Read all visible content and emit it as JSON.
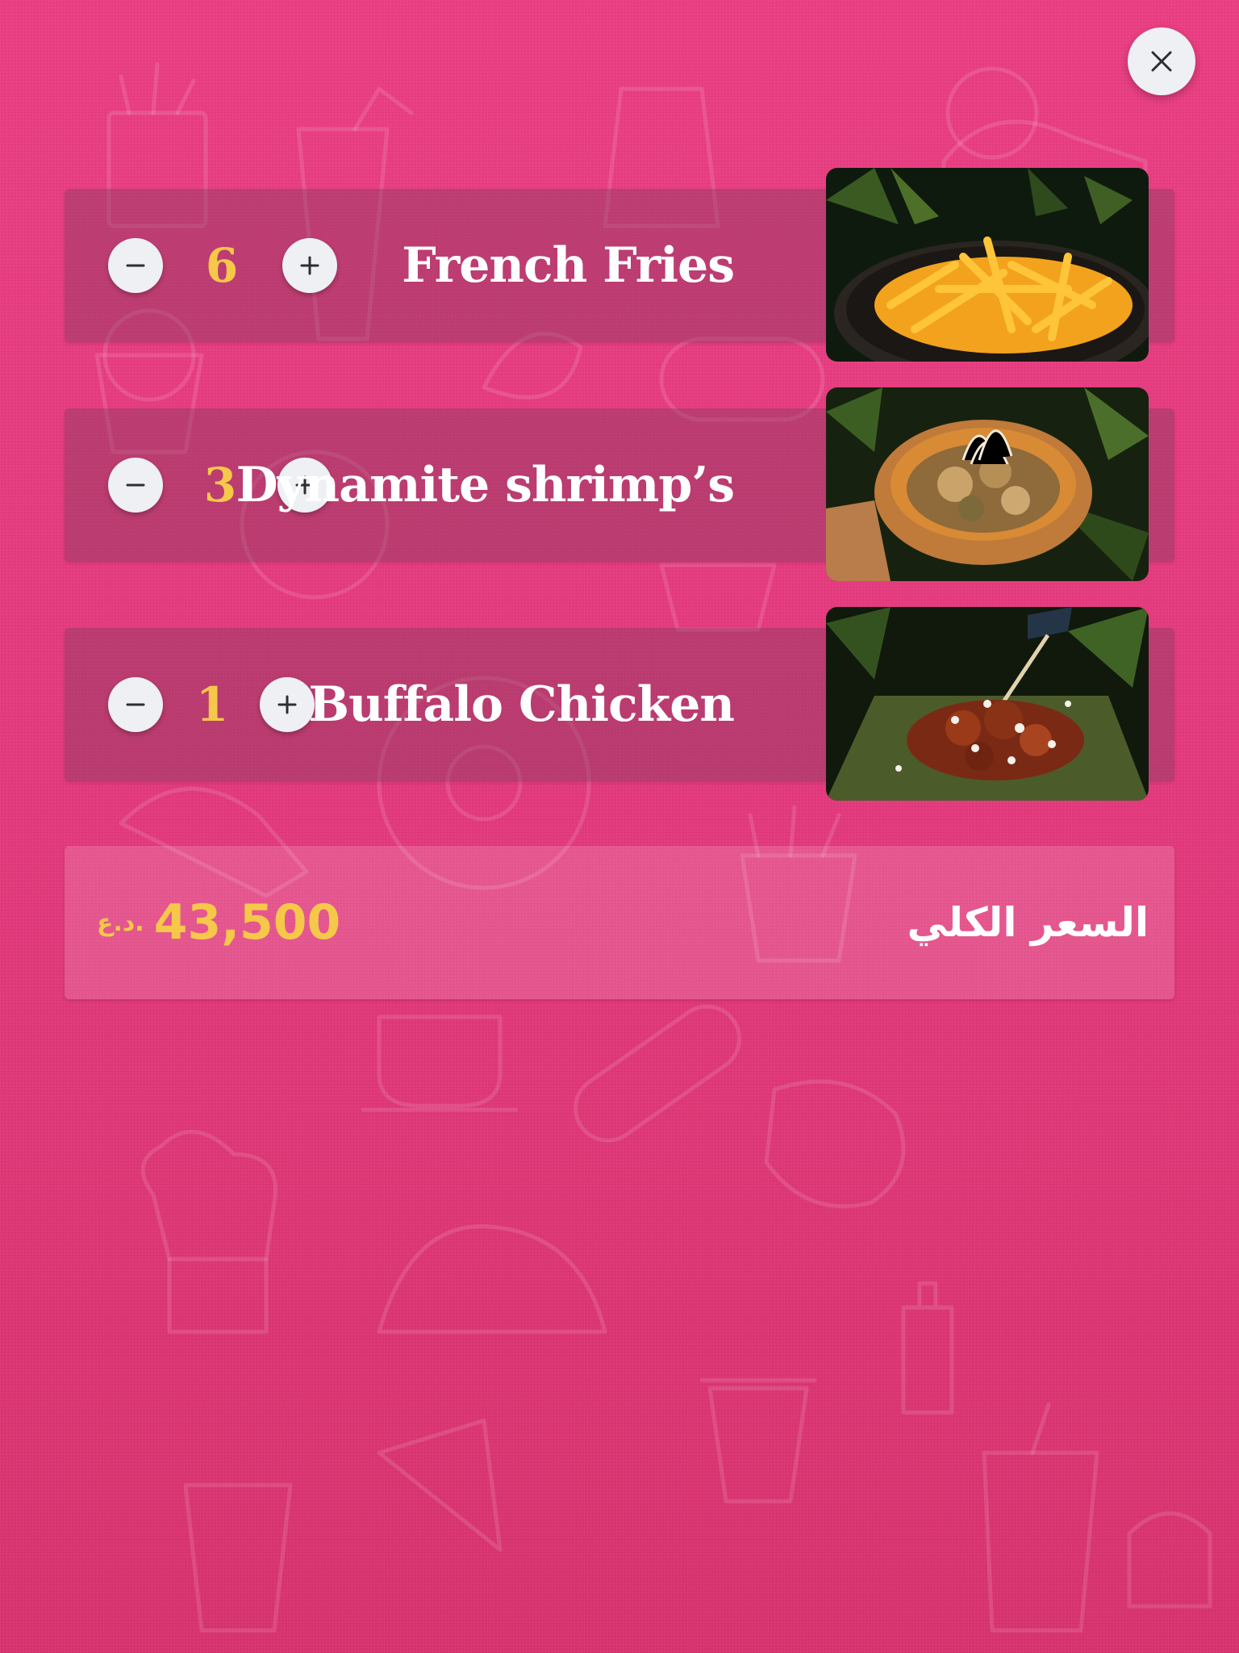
{
  "close_icon": "close-icon",
  "items": [
    {
      "name": "French Fries",
      "quantity": "6",
      "photo": "french-fries-photo"
    },
    {
      "name": "Dynamite shrimp’s",
      "quantity": "3",
      "photo": "dynamite-shrimp-photo"
    },
    {
      "name": "Buffalo Chicken",
      "quantity": "1",
      "photo": "buffalo-chicken-photo"
    }
  ],
  "total": {
    "label": "السعر الكلي",
    "amount": "43,500",
    "currency": "د.ع."
  },
  "colors": {
    "background": "#e33a7d",
    "accent": "#f6c84a",
    "button": "#eef0f3"
  }
}
